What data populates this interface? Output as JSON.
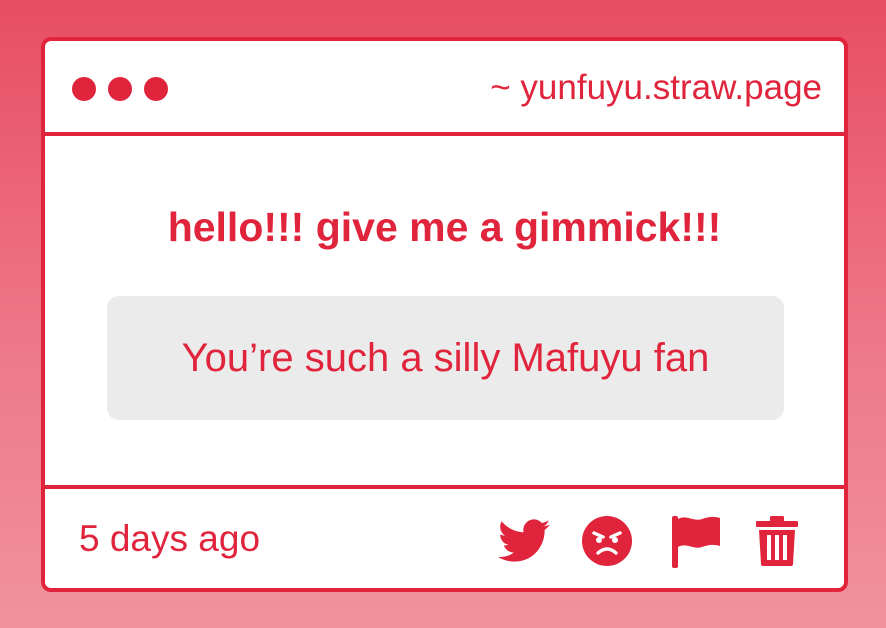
{
  "header": {
    "url": "~ yunfuyu.straw.page",
    "window_dots": 3
  },
  "main": {
    "question": "hello!!! give me a gimmick!!!",
    "answer": "You’re such a silly Mafuyu fan"
  },
  "footer": {
    "timestamp": "5 days ago",
    "actions": [
      {
        "icon": "twitter-icon"
      },
      {
        "icon": "angry-face-icon"
      },
      {
        "icon": "flag-icon"
      },
      {
        "icon": "trash-icon"
      }
    ]
  },
  "colors": {
    "accent": "#e0243c",
    "background_top": "#e84d63",
    "background_bottom": "#f0939c",
    "card": "#ffffff",
    "answer_box": "#ecebec"
  }
}
